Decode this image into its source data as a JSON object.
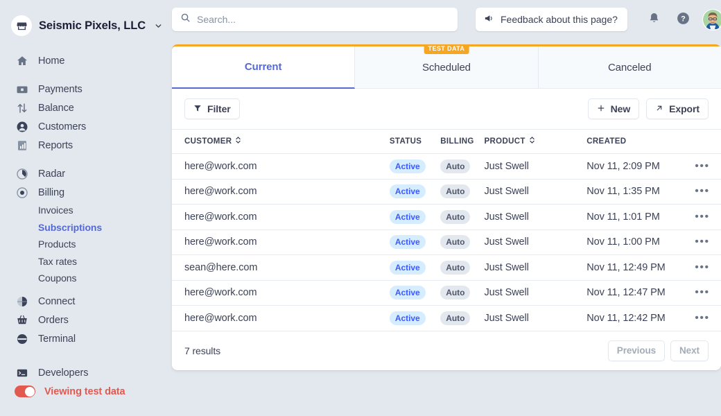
{
  "sidebar": {
    "brand": {
      "name": "Seismic Pixels, LLC",
      "logo_icon": "store-icon",
      "caret_icon": "chevron-down-icon"
    },
    "groups": [
      {
        "items": [
          {
            "label": "Home",
            "icon": "home-icon"
          }
        ]
      },
      {
        "items": [
          {
            "label": "Payments",
            "icon": "payments-icon"
          },
          {
            "label": "Balance",
            "icon": "balance-arrows-icon"
          },
          {
            "label": "Customers",
            "icon": "customer-avatar-icon"
          },
          {
            "label": "Reports",
            "icon": "reports-bar-chart-icon"
          }
        ]
      },
      {
        "items": [
          {
            "label": "Radar",
            "icon": "radar-icon"
          },
          {
            "label": "Billing",
            "icon": "billing-target-icon"
          }
        ]
      }
    ],
    "billing_subnav": [
      {
        "label": "Invoices",
        "active": false
      },
      {
        "label": "Subscriptions",
        "active": true
      },
      {
        "label": "Products",
        "active": false
      },
      {
        "label": "Tax rates",
        "active": false
      },
      {
        "label": "Coupons",
        "active": false
      }
    ],
    "lower_items": [
      {
        "label": "Connect",
        "icon": "connect-globe-icon"
      },
      {
        "label": "Orders",
        "icon": "orders-basket-icon"
      },
      {
        "label": "Terminal",
        "icon": "terminal-reader-icon"
      }
    ],
    "footer": {
      "developers": {
        "label": "Developers",
        "icon": "developers-console-icon"
      },
      "test_toggle": {
        "label": "Viewing test data",
        "on": true,
        "color": "#e25950"
      }
    }
  },
  "topbar": {
    "search": {
      "placeholder": "Search...",
      "value": "",
      "icon": "search-icon"
    },
    "feedback": {
      "label": "Feedback about this page?",
      "icon": "megaphone-icon"
    },
    "notifications_icon": "bell-icon",
    "help_icon": "question-circle-icon",
    "avatar_name": "user-avatar"
  },
  "tabs": [
    {
      "label": "Current",
      "active": true,
      "badge": null
    },
    {
      "label": "Scheduled",
      "active": false,
      "badge": "TEST DATA"
    },
    {
      "label": "Canceled",
      "active": false,
      "badge": null
    }
  ],
  "toolbar": {
    "filter_label": "Filter",
    "filter_icon": "funnel-icon",
    "new_label": "New",
    "new_icon": "plus-icon",
    "export_label": "Export",
    "export_icon": "arrow-up-right-icon"
  },
  "table": {
    "columns": [
      {
        "key": "customer",
        "label": "CUSTOMER",
        "sortable": true
      },
      {
        "key": "status",
        "label": "STATUS",
        "sortable": false
      },
      {
        "key": "billing",
        "label": "BILLING",
        "sortable": false
      },
      {
        "key": "product",
        "label": "PRODUCT",
        "sortable": true
      },
      {
        "key": "created",
        "label": "CREATED",
        "sortable": false
      }
    ],
    "rows": [
      {
        "customer": "here@work.com",
        "status": "Active",
        "billing": "Auto",
        "product": "Just Swell",
        "created": "Nov 11, 2:09 PM"
      },
      {
        "customer": "here@work.com",
        "status": "Active",
        "billing": "Auto",
        "product": "Just Swell",
        "created": "Nov 11, 1:35 PM"
      },
      {
        "customer": "here@work.com",
        "status": "Active",
        "billing": "Auto",
        "product": "Just Swell",
        "created": "Nov 11, 1:01 PM"
      },
      {
        "customer": "here@work.com",
        "status": "Active",
        "billing": "Auto",
        "product": "Just Swell",
        "created": "Nov 11, 1:00 PM"
      },
      {
        "customer": "sean@here.com",
        "status": "Active",
        "billing": "Auto",
        "product": "Just Swell",
        "created": "Nov 11, 12:49 PM"
      },
      {
        "customer": "here@work.com",
        "status": "Active",
        "billing": "Auto",
        "product": "Just Swell",
        "created": "Nov 11, 12:47 PM"
      },
      {
        "customer": "here@work.com",
        "status": "Active",
        "billing": "Auto",
        "product": "Just Swell",
        "created": "Nov 11, 12:42 PM"
      }
    ],
    "row_menu_icon": "ellipsis-icon"
  },
  "footer": {
    "results_text": "7 results",
    "previous_label": "Previous",
    "next_label": "Next",
    "previous_disabled": true,
    "next_disabled": true
  },
  "colors": {
    "accent_blue": "#5469d4",
    "test_orange": "#f5a623",
    "test_red": "#e25950",
    "page_bg": "#e3e8ee",
    "pill_active_bg": "#d6ecff",
    "pill_active_text": "#3d5afe"
  }
}
